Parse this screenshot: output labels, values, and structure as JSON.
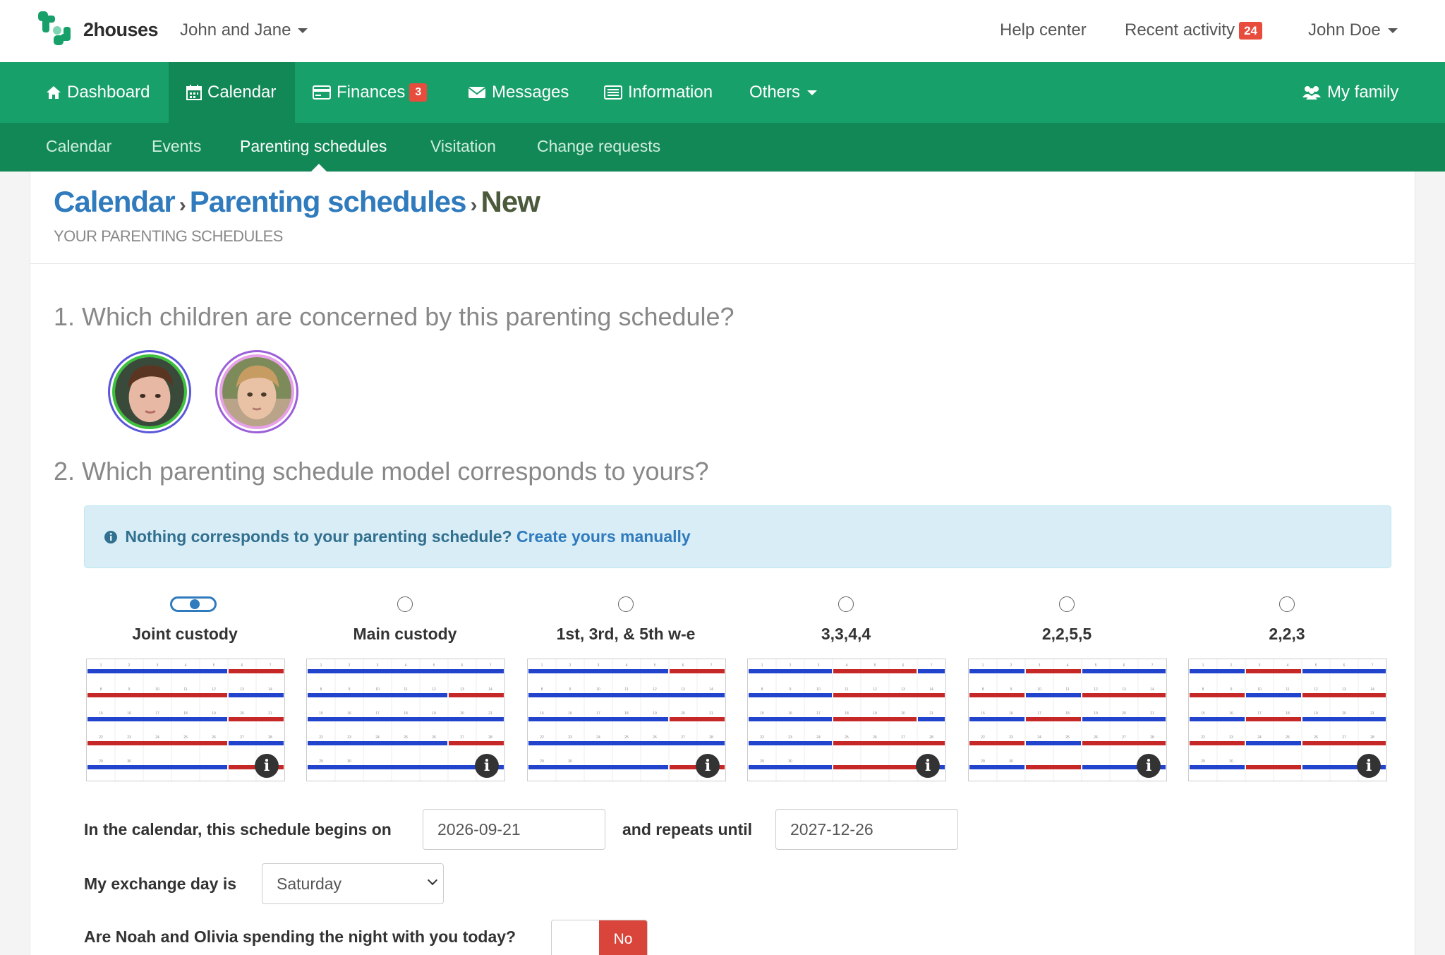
{
  "brand": {
    "name": "2houses"
  },
  "topbar": {
    "family_switch": "John and Jane",
    "help_center": "Help center",
    "recent_activity": "Recent activity",
    "recent_activity_count": "24",
    "user": "John Doe"
  },
  "mainnav": {
    "dashboard": "Dashboard",
    "calendar": "Calendar",
    "finances": "Finances",
    "finances_count": "3",
    "messages": "Messages",
    "information": "Information",
    "others": "Others",
    "my_family": "My family"
  },
  "subnav": {
    "calendar": "Calendar",
    "events": "Events",
    "parenting_schedules": "Parenting schedules",
    "visitation": "Visitation",
    "change_requests": "Change requests"
  },
  "page": {
    "crumb1": "Calendar",
    "crumb2": "Parenting schedules",
    "crumb3": "New",
    "subtitle": "YOUR PARENTING SCHEDULES"
  },
  "questions": {
    "q1": "1. Which children are concerned by this parenting schedule?",
    "q2": "2. Which parenting schedule model corresponds to yours?"
  },
  "info_box": {
    "text": "Nothing corresponds to your parenting schedule?",
    "link": "Create yours manually"
  },
  "models": [
    {
      "label": "Joint custody",
      "selected": true
    },
    {
      "label": "Main custody",
      "selected": false
    },
    {
      "label": "1st, 3rd, & 5th w-e",
      "selected": false
    },
    {
      "label": "3,3,4,4",
      "selected": false
    },
    {
      "label": "2,2,5,5",
      "selected": false
    },
    {
      "label": "2,2,3",
      "selected": false
    }
  ],
  "form": {
    "begins_label": "In the calendar, this schedule begins on",
    "begins_value": "2026-09-21",
    "repeats_label": "and repeats until",
    "repeats_value": "2027-12-26",
    "exchange_label": "My exchange day is",
    "exchange_value": "Saturday",
    "night_label": "Are Noah and Olivia spending the night with you today?",
    "night_value": "No"
  },
  "colors": {
    "primary_green": "#18a06a",
    "dark_green": "#138857",
    "link_blue": "#2f7bbd",
    "parent_blue": "#2244cc",
    "parent_red": "#c62828",
    "badge_red": "#e74c3c"
  }
}
